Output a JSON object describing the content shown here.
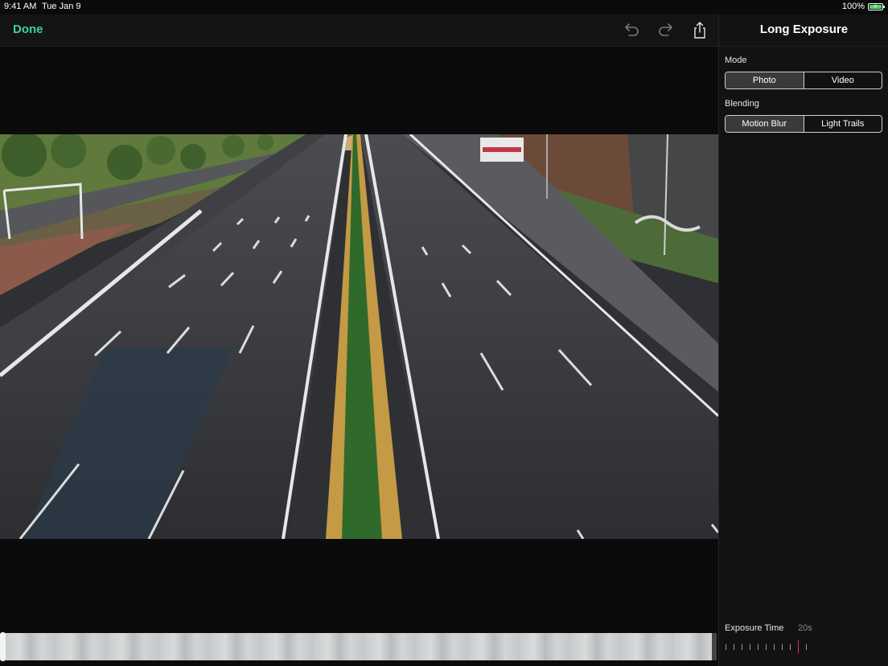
{
  "status_bar": {
    "time": "9:41 AM",
    "date": "Tue Jan 9",
    "battery": "100%"
  },
  "toolbar": {
    "done_label": "Done",
    "undo_icon": "undo-icon",
    "redo_icon": "redo-icon",
    "share_icon": "share-icon"
  },
  "sidebar": {
    "title": "Long Exposure",
    "mode": {
      "label": "Mode",
      "options": [
        "Photo",
        "Video"
      ],
      "selected": "Photo"
    },
    "blending": {
      "label": "Blending",
      "options": [
        "Motion Blur",
        "Light Trails"
      ],
      "selected": "Motion Blur"
    },
    "exposure": {
      "label": "Exposure Time",
      "value": "20s"
    }
  },
  "colors": {
    "accent": "#38d39f",
    "slider_marker": "#e0335a",
    "background": "#0b0b0b"
  }
}
